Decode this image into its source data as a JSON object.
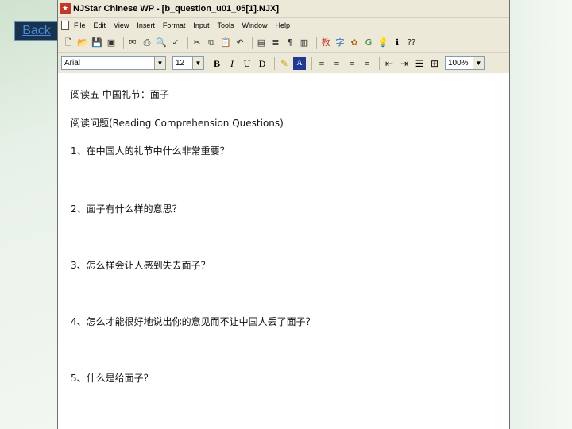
{
  "back_button": "Back",
  "window": {
    "title": "NJStar Chinese WP - [b_question_u01_05[1].NJX]"
  },
  "menu": [
    "File",
    "Edit",
    "View",
    "Insert",
    "Format",
    "Input",
    "Tools",
    "Window",
    "Help"
  ],
  "formatting": {
    "font": "Arial",
    "size": "12",
    "zoom": "100%",
    "bold_label": "B",
    "italic_label": "I",
    "underline_label": "U"
  },
  "toolbar_icons": [
    "new-icon",
    "open-icon",
    "save-icon",
    "save-all-icon",
    "sep",
    "email-icon",
    "print-icon",
    "print-preview-icon",
    "spellcheck-icon",
    "sep",
    "cut-icon",
    "copy-icon",
    "paste-icon",
    "undo-icon",
    "sep",
    "table-icon",
    "insert-text-icon",
    "paragraph-mark-icon",
    "sep",
    "dictionary-icon",
    "chinese-input-icon",
    "settings-icon",
    "big5-gb-icon",
    "hint-icon",
    "info-icon",
    "help-icon"
  ],
  "document": {
    "heading": "阅读五 中国礼节：面子",
    "subheading": "阅读问题(Reading Comprehension Questions)",
    "questions": [
      "1、在中国人的礼节中什么非常重要？",
      "2、面子有什么样的意思？",
      "3、怎么样会让人感到失去面子？",
      "4、怎么才能很好地说出你的意见而不让中国人丢了面子？",
      "5、什么是给面子？"
    ]
  }
}
